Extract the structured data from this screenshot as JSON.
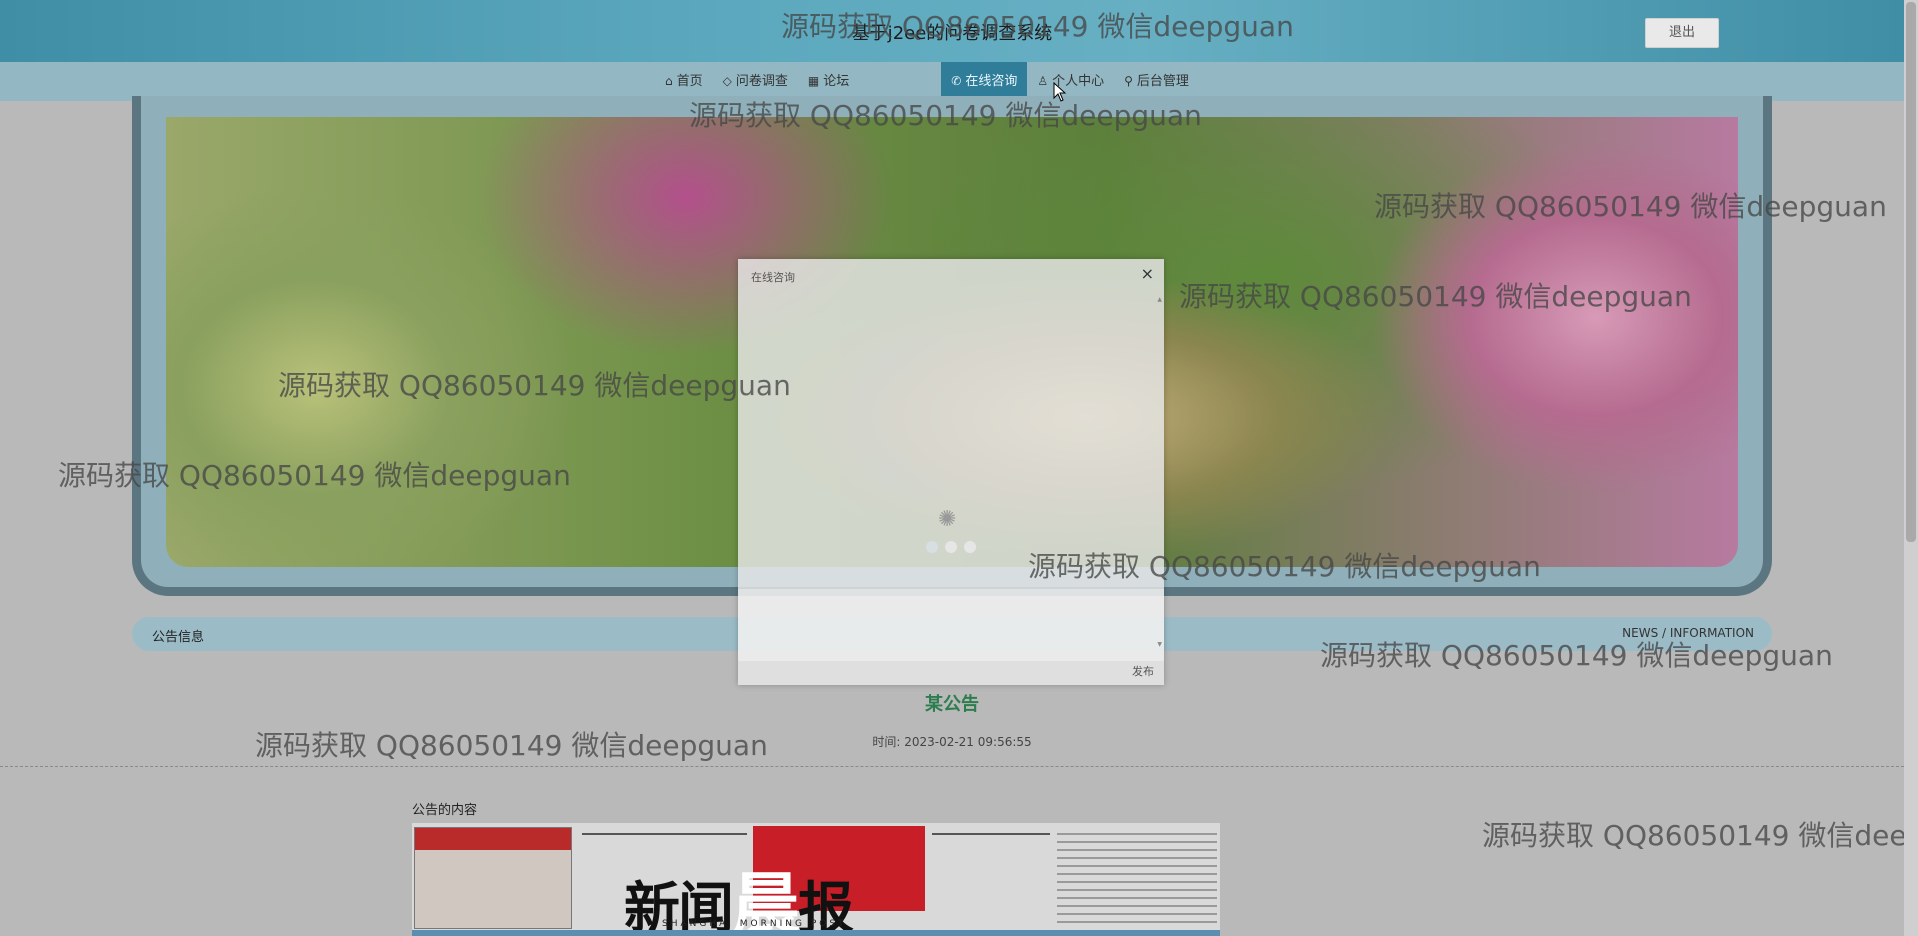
{
  "header": {
    "title": "基于j2ee的问卷调查系统",
    "logout_label": "退出"
  },
  "nav": {
    "items": [
      {
        "label": "首页",
        "icon": "home-icon",
        "glyph": "⌂"
      },
      {
        "label": "问卷调查",
        "icon": "tag-icon",
        "glyph": "◇"
      },
      {
        "label": "论坛",
        "icon": "forum-icon",
        "glyph": "▦"
      },
      {
        "label": "在线咨询",
        "icon": "chat-icon",
        "glyph": "✆"
      },
      {
        "label": "个人中心",
        "icon": "user-icon",
        "glyph": "♙"
      },
      {
        "label": "后台管理",
        "icon": "link-icon",
        "glyph": "⚲"
      }
    ],
    "active_label": "在线咨询"
  },
  "banner": {
    "slides_count": 3,
    "active_slide": 1
  },
  "notice_bar": {
    "title": "公告信息",
    "subtitle_en": "NEWS / INFORMATION"
  },
  "article": {
    "title": "某公告",
    "time_label": "时间:",
    "time_value": "2023-02-21 09:56:55",
    "content_label": "公告的内容",
    "newspaper_name_part1": "新闻",
    "newspaper_name_part2": "晨",
    "newspaper_name_part3": "报",
    "newspaper_subtitle": "SHANGHAI MORNING POST"
  },
  "modal": {
    "title": "在线咨询",
    "close_glyph": "×",
    "send_label": "发布",
    "input_value": ""
  },
  "watermark_text": "源码获取 QQ86050149 微信deepguan",
  "colors": {
    "header_bg": "#5aa7bd",
    "nav_bg": "#93b8c4",
    "nav_active_bg": "#2f7d98",
    "article_title": "#2e7d4e"
  }
}
